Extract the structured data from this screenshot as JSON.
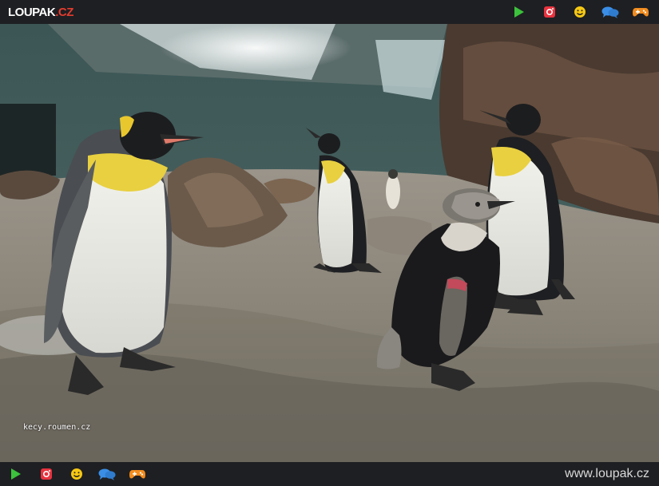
{
  "header": {
    "logo_main": "LOUPAK",
    "logo_tld": ".CZ",
    "icons": [
      "play-icon",
      "instagram-icon",
      "smiley-icon",
      "chat-icon",
      "gamepad-icon"
    ]
  },
  "photo": {
    "watermark": "kecy.roumen.cz"
  },
  "footer": {
    "icons": [
      "play-icon",
      "instagram-icon",
      "smiley-icon",
      "chat-icon",
      "gamepad-icon"
    ],
    "site_url": "www.loupak.cz"
  },
  "colors": {
    "bar_background": "#1e1f22",
    "logo_accent": "#e43c2f",
    "play": "#3cc23c",
    "instagram": "#e8333f",
    "smiley": "#f6c814",
    "chat": "#3a8ee6",
    "gamepad": "#f28c1e"
  }
}
